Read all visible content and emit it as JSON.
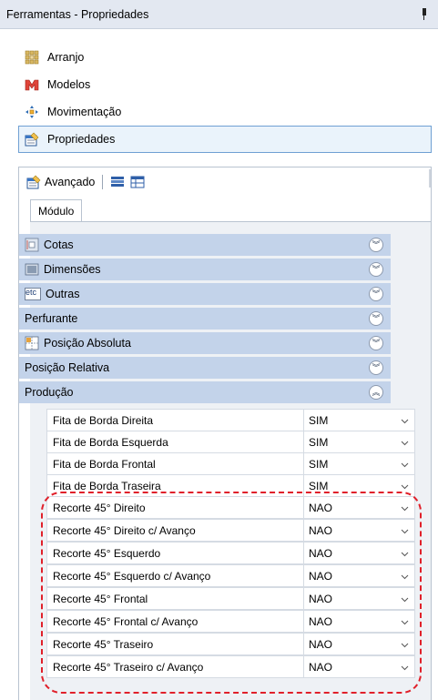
{
  "title_bar": {
    "title": "Ferramentas - Propriedades",
    "pin_icon": "pin-icon"
  },
  "nav": {
    "items": [
      {
        "label": "Arranjo",
        "icon": "grid-icon"
      },
      {
        "label": "Modelos",
        "icon": "models-icon"
      },
      {
        "label": "Movimentação",
        "icon": "move-arrows-icon"
      },
      {
        "label": "Propriedades",
        "icon": "properties-icon",
        "active": true
      }
    ]
  },
  "toolbar": {
    "label": "Avançado",
    "icons": [
      "properties-icon",
      "list-view-icon",
      "table-view-icon"
    ]
  },
  "tab": {
    "label": "Módulo"
  },
  "groups": [
    {
      "label": "Cotas",
      "icon": "dimension-icon",
      "expanded": false
    },
    {
      "label": "Dimensões",
      "icon": "dimensions-box-icon",
      "expanded": false
    },
    {
      "label": "Outras",
      "icon": "etc-icon",
      "icon_text": "etc",
      "expanded": false
    },
    {
      "label": "Perfurante",
      "icon": "",
      "expanded": false
    },
    {
      "label": "Posição Absoluta",
      "icon": "position-icon",
      "expanded": false
    },
    {
      "label": "Posição Relativa",
      "icon": "",
      "expanded": false
    },
    {
      "label": "Produção",
      "icon": "",
      "expanded": true
    }
  ],
  "properties": [
    {
      "label": "Fita de Borda Direita",
      "value": "SIM"
    },
    {
      "label": "Fita de Borda Esquerda",
      "value": "SIM"
    },
    {
      "label": "Fita de Borda Frontal",
      "value": "SIM"
    },
    {
      "label": "Fita de Borda Traseira",
      "value": "SIM"
    },
    {
      "label": "Recorte 45° Direito",
      "value": "NAO"
    },
    {
      "label": "Recorte 45° Direito c/ Avanço",
      "value": "NAO"
    },
    {
      "label": "Recorte 45° Esquerdo",
      "value": "NAO"
    },
    {
      "label": "Recorte 45° Esquerdo c/ Avanço",
      "value": "NAO"
    },
    {
      "label": "Recorte 45° Frontal",
      "value": "NAO"
    },
    {
      "label": "Recorte 45° Frontal c/ Avanço",
      "value": "NAO"
    },
    {
      "label": "Recorte 45° Traseiro",
      "value": "NAO"
    },
    {
      "label": "Recorte 45° Traseiro c/ Avanço",
      "value": "NAO"
    }
  ],
  "colors": {
    "group_bg": "#c3d3ea",
    "highlight": "#e0202a",
    "active_border": "#6fa0d3"
  }
}
